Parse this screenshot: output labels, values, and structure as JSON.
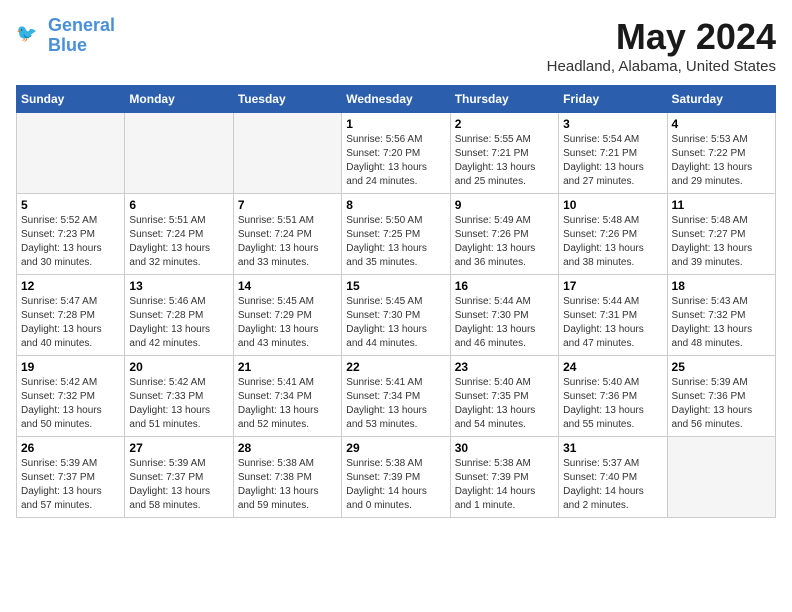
{
  "header": {
    "logo_line1": "General",
    "logo_line2": "Blue",
    "month_title": "May 2024",
    "location": "Headland, Alabama, United States"
  },
  "weekdays": [
    "Sunday",
    "Monday",
    "Tuesday",
    "Wednesday",
    "Thursday",
    "Friday",
    "Saturday"
  ],
  "weeks": [
    [
      {
        "day": "",
        "empty": true
      },
      {
        "day": "",
        "empty": true
      },
      {
        "day": "",
        "empty": true
      },
      {
        "day": "1",
        "sunrise": "5:56 AM",
        "sunset": "7:20 PM",
        "daylight": "13 hours and 24 minutes."
      },
      {
        "day": "2",
        "sunrise": "5:55 AM",
        "sunset": "7:21 PM",
        "daylight": "13 hours and 25 minutes."
      },
      {
        "day": "3",
        "sunrise": "5:54 AM",
        "sunset": "7:21 PM",
        "daylight": "13 hours and 27 minutes."
      },
      {
        "day": "4",
        "sunrise": "5:53 AM",
        "sunset": "7:22 PM",
        "daylight": "13 hours and 29 minutes."
      }
    ],
    [
      {
        "day": "5",
        "sunrise": "5:52 AM",
        "sunset": "7:23 PM",
        "daylight": "13 hours and 30 minutes."
      },
      {
        "day": "6",
        "sunrise": "5:51 AM",
        "sunset": "7:24 PM",
        "daylight": "13 hours and 32 minutes."
      },
      {
        "day": "7",
        "sunrise": "5:51 AM",
        "sunset": "7:24 PM",
        "daylight": "13 hours and 33 minutes."
      },
      {
        "day": "8",
        "sunrise": "5:50 AM",
        "sunset": "7:25 PM",
        "daylight": "13 hours and 35 minutes."
      },
      {
        "day": "9",
        "sunrise": "5:49 AM",
        "sunset": "7:26 PM",
        "daylight": "13 hours and 36 minutes."
      },
      {
        "day": "10",
        "sunrise": "5:48 AM",
        "sunset": "7:26 PM",
        "daylight": "13 hours and 38 minutes."
      },
      {
        "day": "11",
        "sunrise": "5:48 AM",
        "sunset": "7:27 PM",
        "daylight": "13 hours and 39 minutes."
      }
    ],
    [
      {
        "day": "12",
        "sunrise": "5:47 AM",
        "sunset": "7:28 PM",
        "daylight": "13 hours and 40 minutes."
      },
      {
        "day": "13",
        "sunrise": "5:46 AM",
        "sunset": "7:28 PM",
        "daylight": "13 hours and 42 minutes."
      },
      {
        "day": "14",
        "sunrise": "5:45 AM",
        "sunset": "7:29 PM",
        "daylight": "13 hours and 43 minutes."
      },
      {
        "day": "15",
        "sunrise": "5:45 AM",
        "sunset": "7:30 PM",
        "daylight": "13 hours and 44 minutes."
      },
      {
        "day": "16",
        "sunrise": "5:44 AM",
        "sunset": "7:30 PM",
        "daylight": "13 hours and 46 minutes."
      },
      {
        "day": "17",
        "sunrise": "5:44 AM",
        "sunset": "7:31 PM",
        "daylight": "13 hours and 47 minutes."
      },
      {
        "day": "18",
        "sunrise": "5:43 AM",
        "sunset": "7:32 PM",
        "daylight": "13 hours and 48 minutes."
      }
    ],
    [
      {
        "day": "19",
        "sunrise": "5:42 AM",
        "sunset": "7:32 PM",
        "daylight": "13 hours and 50 minutes."
      },
      {
        "day": "20",
        "sunrise": "5:42 AM",
        "sunset": "7:33 PM",
        "daylight": "13 hours and 51 minutes."
      },
      {
        "day": "21",
        "sunrise": "5:41 AM",
        "sunset": "7:34 PM",
        "daylight": "13 hours and 52 minutes."
      },
      {
        "day": "22",
        "sunrise": "5:41 AM",
        "sunset": "7:34 PM",
        "daylight": "13 hours and 53 minutes."
      },
      {
        "day": "23",
        "sunrise": "5:40 AM",
        "sunset": "7:35 PM",
        "daylight": "13 hours and 54 minutes."
      },
      {
        "day": "24",
        "sunrise": "5:40 AM",
        "sunset": "7:36 PM",
        "daylight": "13 hours and 55 minutes."
      },
      {
        "day": "25",
        "sunrise": "5:39 AM",
        "sunset": "7:36 PM",
        "daylight": "13 hours and 56 minutes."
      }
    ],
    [
      {
        "day": "26",
        "sunrise": "5:39 AM",
        "sunset": "7:37 PM",
        "daylight": "13 hours and 57 minutes."
      },
      {
        "day": "27",
        "sunrise": "5:39 AM",
        "sunset": "7:37 PM",
        "daylight": "13 hours and 58 minutes."
      },
      {
        "day": "28",
        "sunrise": "5:38 AM",
        "sunset": "7:38 PM",
        "daylight": "13 hours and 59 minutes."
      },
      {
        "day": "29",
        "sunrise": "5:38 AM",
        "sunset": "7:39 PM",
        "daylight": "14 hours and 0 minutes."
      },
      {
        "day": "30",
        "sunrise": "5:38 AM",
        "sunset": "7:39 PM",
        "daylight": "14 hours and 1 minute."
      },
      {
        "day": "31",
        "sunrise": "5:37 AM",
        "sunset": "7:40 PM",
        "daylight": "14 hours and 2 minutes."
      },
      {
        "day": "",
        "empty": true
      }
    ]
  ],
  "labels": {
    "sunrise": "Sunrise:",
    "sunset": "Sunset:",
    "daylight": "Daylight:"
  }
}
